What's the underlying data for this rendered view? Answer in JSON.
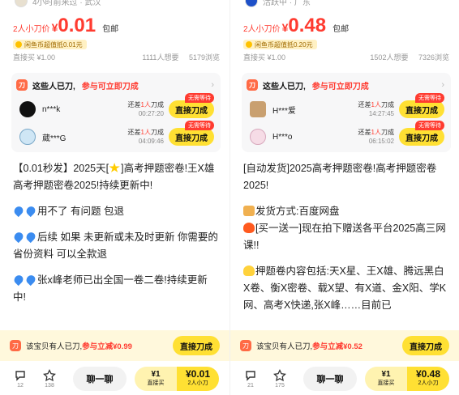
{
  "left": {
    "seller_info": "4小时前来过 · 武汉",
    "price_label": "2人小刀价",
    "price_yen": "¥",
    "price_value": "0.01",
    "shipping": "包邮",
    "badge": "闲鱼币超值抵0.01元",
    "direct_price": "直接买 ¥1.00",
    "wants": "1111人想要",
    "views": "5179浏览",
    "cut_title": "这些人已刀,",
    "cut_highlight": "参与可立即刀成",
    "cutters": [
      {
        "name": "n***k",
        "need_prefix": "还差",
        "need_num": "1人",
        "need_suffix": "刀成",
        "time": "00:27:20",
        "btn": "直接刀成",
        "tag": "无需等待"
      },
      {
        "name": "葳***G",
        "need_prefix": "还差",
        "need_num": "1人",
        "need_suffix": "刀成",
        "time": "04:09:46",
        "btn": "直接刀成",
        "tag": "无需等待"
      }
    ],
    "desc": [
      "【0.01秒发】2025天[",
      "]高考押题密卷!王X雄高考押题密卷2025!持续更新中!",
      "用不了 有问题 包退",
      "后续 如果 未更新或未及时更新 你需要的省份资料 可以全款退",
      "张x峰老师已出全国一卷二卷!持续更新中!"
    ],
    "promo_text": "该宝贝有人已刀,",
    "promo_highlight": "参与立减¥0.99",
    "promo_btn": "直接刀成",
    "comments": "12",
    "favorites": "138",
    "chat": "聊一聊",
    "buy_price": "¥1",
    "buy_label": "直接买",
    "cut_price": "¥0.01",
    "cut_label": "2人小刀"
  },
  "right": {
    "seller_info": "活跃中 · 广东",
    "price_label": "2人小刀价",
    "price_yen": "¥",
    "price_value": "0.48",
    "shipping": "包邮",
    "badge": "闲鱼币超值抵0.20元",
    "direct_price": "直接买 ¥1.00",
    "wants": "1502人想要",
    "views": "7326浏览",
    "cut_title": "这些人已刀,",
    "cut_highlight": "参与可立即刀成",
    "cutters": [
      {
        "name": "H***爱",
        "need_prefix": "还差",
        "need_num": "1人",
        "need_suffix": "刀成",
        "time": "14:27:45",
        "btn": "直接刀成",
        "tag": "无需等待"
      },
      {
        "name": "H***o",
        "need_prefix": "还差",
        "need_num": "1人",
        "need_suffix": "刀成",
        "time": "06:15:02",
        "btn": "直接刀成",
        "tag": "无需等待"
      }
    ],
    "desc": [
      "[自动发货]2025高考押题密卷!高考押题密卷2025!",
      "发货方式:百度网盘",
      "[买一送一]现在拍下赠送各平台2025高三网课!!",
      "押题卷内容包括:天X星、王X雄、腾远黑白X卷、衡X密卷、载X望、有X道、金X阳、学K网、高考X快递,张X峰……目前已"
    ],
    "promo_text": "该宝贝有人已刀,",
    "promo_highlight": "参与立减¥0.52",
    "promo_btn": "直接刀成",
    "comments": "21",
    "favorites": "175",
    "chat": "聊一聊",
    "buy_price": "¥1",
    "buy_label": "直接买",
    "cut_price": "¥0.48",
    "cut_label": "2人小刀"
  },
  "colors": {
    "accent_red": "#ff3b30",
    "button_yellow": "#ffe033",
    "promo_bg": "#fff8dc"
  }
}
